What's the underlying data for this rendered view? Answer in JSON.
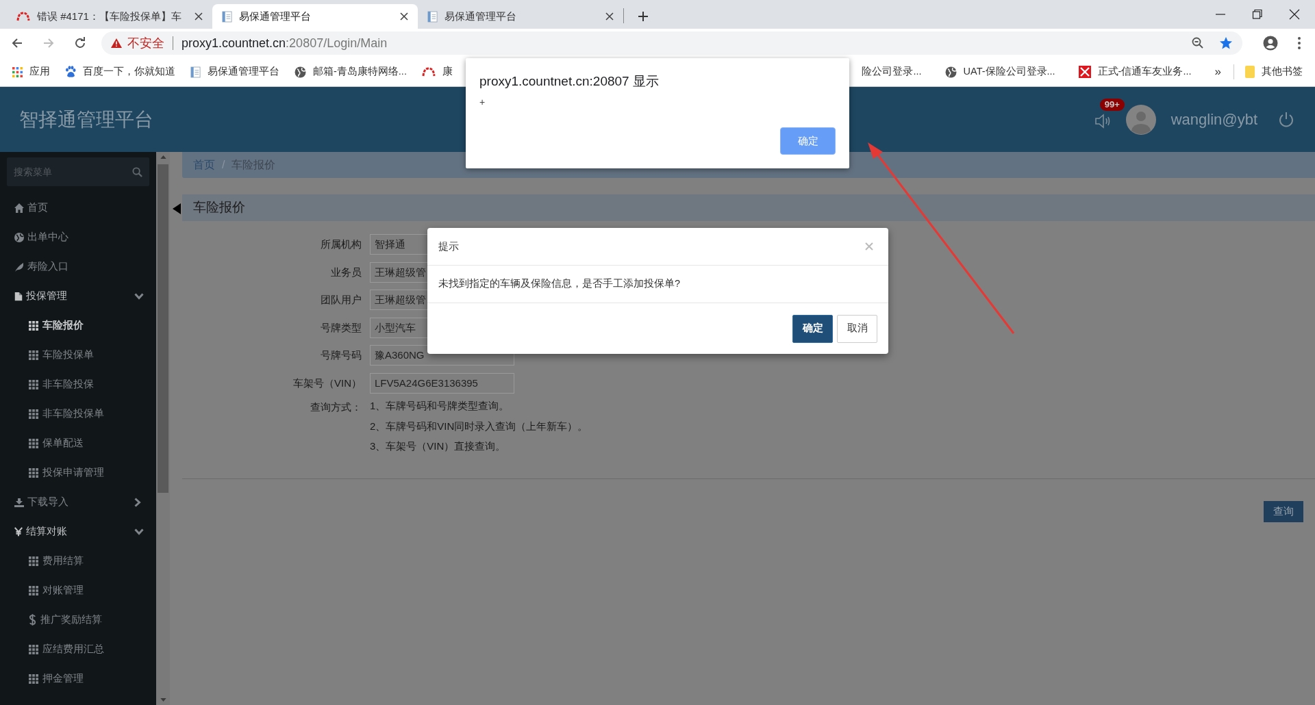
{
  "browser": {
    "tabs": [
      {
        "title": "错误 #4171：【车险投保单】车",
        "selected": false
      },
      {
        "title": "易保通管理平台",
        "selected": true
      },
      {
        "title": "易保通管理平台",
        "selected": false
      }
    ],
    "address": {
      "security": "不安全",
      "host": "proxy1.countnet.cn",
      "path": ":20807/Login/Main"
    },
    "bookmarks": [
      "应用",
      "百度一下，你就知道",
      "易保通管理平台",
      "邮箱-青岛康特网络...",
      "康"
    ],
    "bookmarks_right": [
      "险公司登录...",
      "UAT-保险公司登录...",
      "正式-信通车友业务..."
    ],
    "more": "»",
    "other_bookmarks": "其他书签"
  },
  "app": {
    "title": "智择通管理平台",
    "badge": "99+",
    "user": "wanglin@ybt"
  },
  "sidebar": {
    "search_placeholder": "搜索菜单",
    "items": [
      {
        "label": "首页",
        "selected": false
      },
      {
        "label": "出单中心",
        "selected": false
      },
      {
        "label": "寿险入口",
        "selected": false
      },
      {
        "label": "投保管理",
        "selected": false,
        "expanded": true,
        "children": [
          {
            "label": "车险报价",
            "selected": true
          },
          {
            "label": "车险投保单",
            "selected": false
          },
          {
            "label": "非车险投保",
            "selected": false
          },
          {
            "label": "非车险投保单",
            "selected": false
          },
          {
            "label": "保单配送",
            "selected": false
          },
          {
            "label": "投保申请管理",
            "selected": false
          }
        ]
      },
      {
        "label": "下载导入",
        "selected": false,
        "expanded": false
      },
      {
        "label": "结算对账",
        "selected": false,
        "expanded": true,
        "children": [
          {
            "label": "费用结算",
            "selected": false
          },
          {
            "label": "对账管理",
            "selected": false
          },
          {
            "label": "推广奖励结算",
            "selected": false
          },
          {
            "label": "应结费用汇总",
            "selected": false
          },
          {
            "label": "押金管理",
            "selected": false
          }
        ]
      }
    ]
  },
  "breadcrumb": [
    "首页",
    "车险报价"
  ],
  "breadcrumb_separator": "/",
  "panel": {
    "title": "车险报价",
    "fields": [
      {
        "label": "所属机构",
        "value": "智择通"
      },
      {
        "label": "业务员",
        "value": "王琳超级管"
      },
      {
        "label": "团队用户",
        "value": "王琳超级管"
      },
      {
        "label": "号牌类型",
        "value": "小型汽车"
      },
      {
        "label": "号牌号码",
        "value": "豫A360NG"
      },
      {
        "label": "车架号（VIN）",
        "value": "LFV5A24G6E3136395"
      }
    ],
    "query_label": "查询方式：",
    "query_methods": [
      "1、车牌号码和号牌类型查询。",
      "2、车牌号码和VIN同时录入查询（上年新车）。",
      "3、车架号（VIN）直接查询。"
    ]
  },
  "query_button": "查询",
  "alert": {
    "title": "proxy1.countnet.cn:20807 显示",
    "message": "+",
    "button": "确定"
  },
  "dialog": {
    "title": "提示",
    "message": "未找到指定的车辆及保险信息，是否手工添加投保单?",
    "buttons": [
      "确定",
      "取消"
    ]
  }
}
